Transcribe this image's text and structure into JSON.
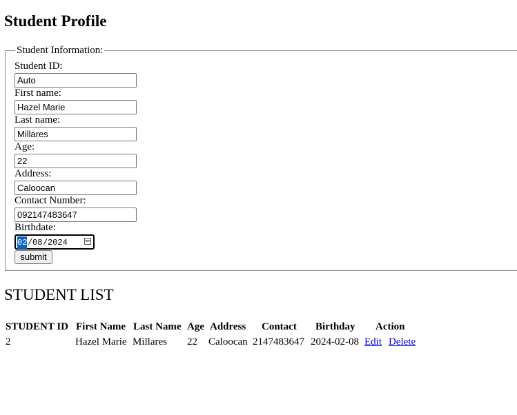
{
  "page_title": "Student Profile",
  "form": {
    "legend": "Student Information:",
    "fields": {
      "student_id": {
        "label": "Student ID:",
        "value": "Auto"
      },
      "first_name": {
        "label": "First name:",
        "value": "Hazel Marie"
      },
      "last_name": {
        "label": "Last name:",
        "value": "Millares"
      },
      "age": {
        "label": "Age:",
        "value": "22"
      },
      "address": {
        "label": "Address:",
        "value": "Caloocan"
      },
      "contact": {
        "label": "Contact Number:",
        "value": "092147483647"
      },
      "birthdate": {
        "label": "Birthdate:",
        "month": "02",
        "sep1": "/",
        "day": "08",
        "sep2": "/",
        "year": "2024"
      }
    },
    "submit_label": "submit"
  },
  "list": {
    "title": "STUDENT LIST",
    "headers": [
      "STUDENT ID",
      "First Name",
      "Last Name",
      "Age",
      "Address",
      "Contact",
      "Birthday",
      "Action"
    ],
    "rows": [
      {
        "student_id": "2",
        "first_name": "Hazel Marie",
        "last_name": "Millares",
        "age": "22",
        "address": "Caloocan",
        "contact": "2147483647",
        "birthday": "2024-02-08",
        "edit_label": "Edit",
        "delete_label": "Delete"
      }
    ]
  },
  "colors": {
    "link": "#0000ee",
    "date_selection": "#0a64c8"
  },
  "icons": {
    "date_picker": "calendar-icon"
  }
}
